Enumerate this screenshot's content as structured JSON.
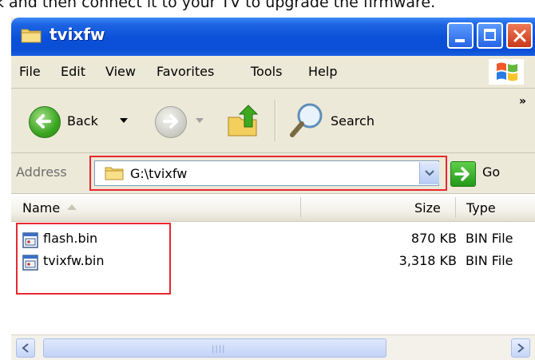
{
  "caption": "k and then connect it to your TV to upgrade the firmware.",
  "window": {
    "title": "tvixfw",
    "buttons": {
      "minimize": "minimize",
      "maximize": "maximize",
      "close": "close"
    }
  },
  "menu": {
    "items": [
      {
        "label": "File"
      },
      {
        "label": "Edit"
      },
      {
        "label": "View"
      },
      {
        "label": "Favorites"
      },
      {
        "label": "Tools"
      },
      {
        "label": "Help"
      }
    ]
  },
  "toolbar": {
    "back_label": "Back",
    "search_label": "Search",
    "overflow": "»"
  },
  "address": {
    "label": "Address",
    "value": "G:\\tvixfw",
    "go_label": "Go"
  },
  "columns": {
    "name": "Name",
    "size": "Size",
    "type": "Type"
  },
  "files": [
    {
      "name": "flash.bin",
      "size": "870 KB",
      "type": "BIN File"
    },
    {
      "name": "tvixfw.bin",
      "size": "3,318 KB",
      "type": "BIN File"
    }
  ],
  "colors": {
    "title_blue": "#0a50d8",
    "highlight_red": "#e8272f",
    "chrome": "#ece9d8"
  }
}
